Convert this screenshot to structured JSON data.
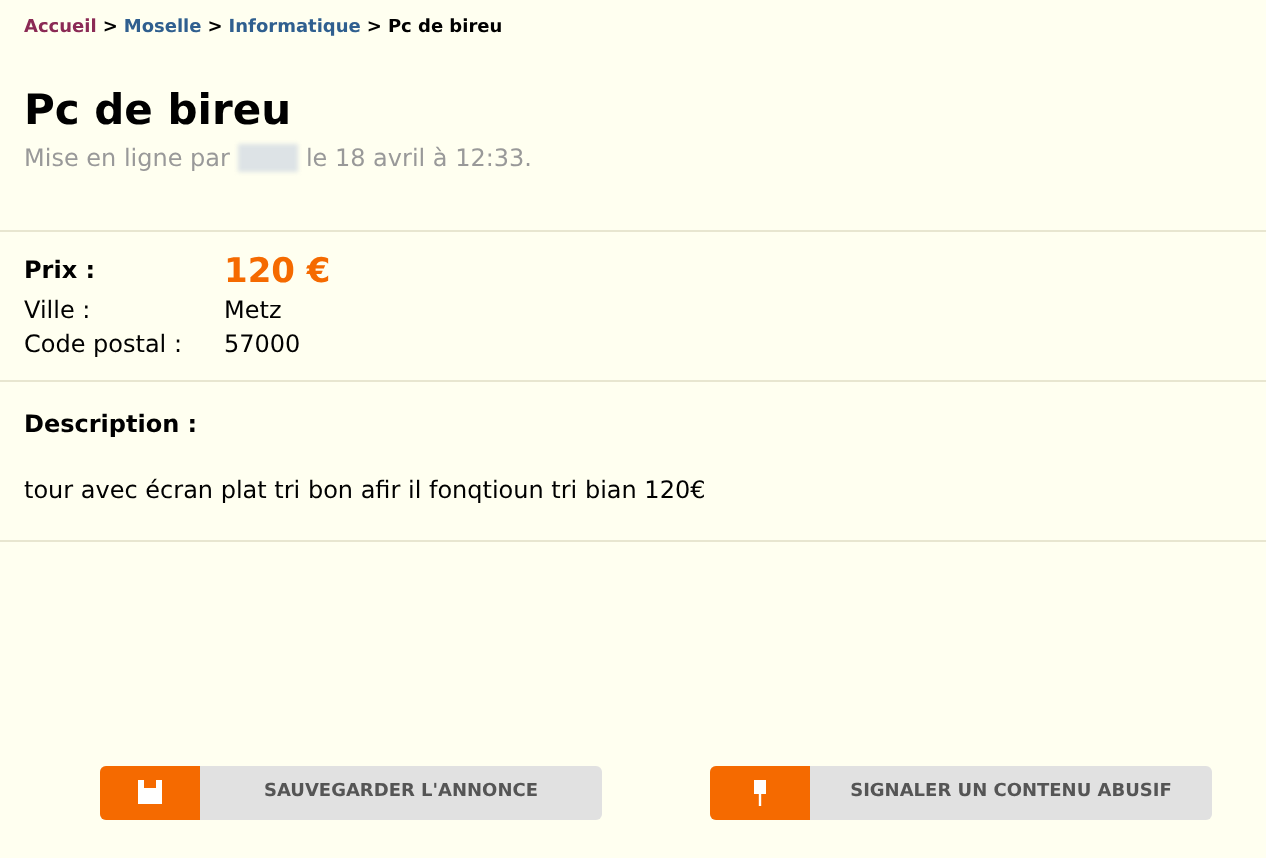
{
  "breadcrumb": [
    {
      "label": "Accueil",
      "kind": "home"
    },
    {
      "label": "Moselle",
      "kind": "link"
    },
    {
      "label": "Informatique",
      "kind": "link"
    },
    {
      "label": "Pc de bireu",
      "kind": "current"
    }
  ],
  "separator": ">",
  "title": "Pc de bireu",
  "posted": {
    "before": "Mise en ligne par",
    "after": "le 18 avril à 12:33."
  },
  "details": [
    {
      "label": "Prix :",
      "value": "120 €",
      "kind": "price"
    },
    {
      "label": "Ville :",
      "value": "Metz",
      "kind": "plain"
    },
    {
      "label": "Code postal :",
      "value": "57000",
      "kind": "plain"
    }
  ],
  "description": {
    "heading": "Description :",
    "text": "tour avec écran plat tri bon afir il fonqtioun tri bian 120€"
  },
  "buttons": [
    {
      "label": "SAUVEGARDER L'ANNONCE",
      "kind": "save"
    },
    {
      "label": "SIGNALER UN CONTENU ABUSIF",
      "kind": "report"
    }
  ]
}
